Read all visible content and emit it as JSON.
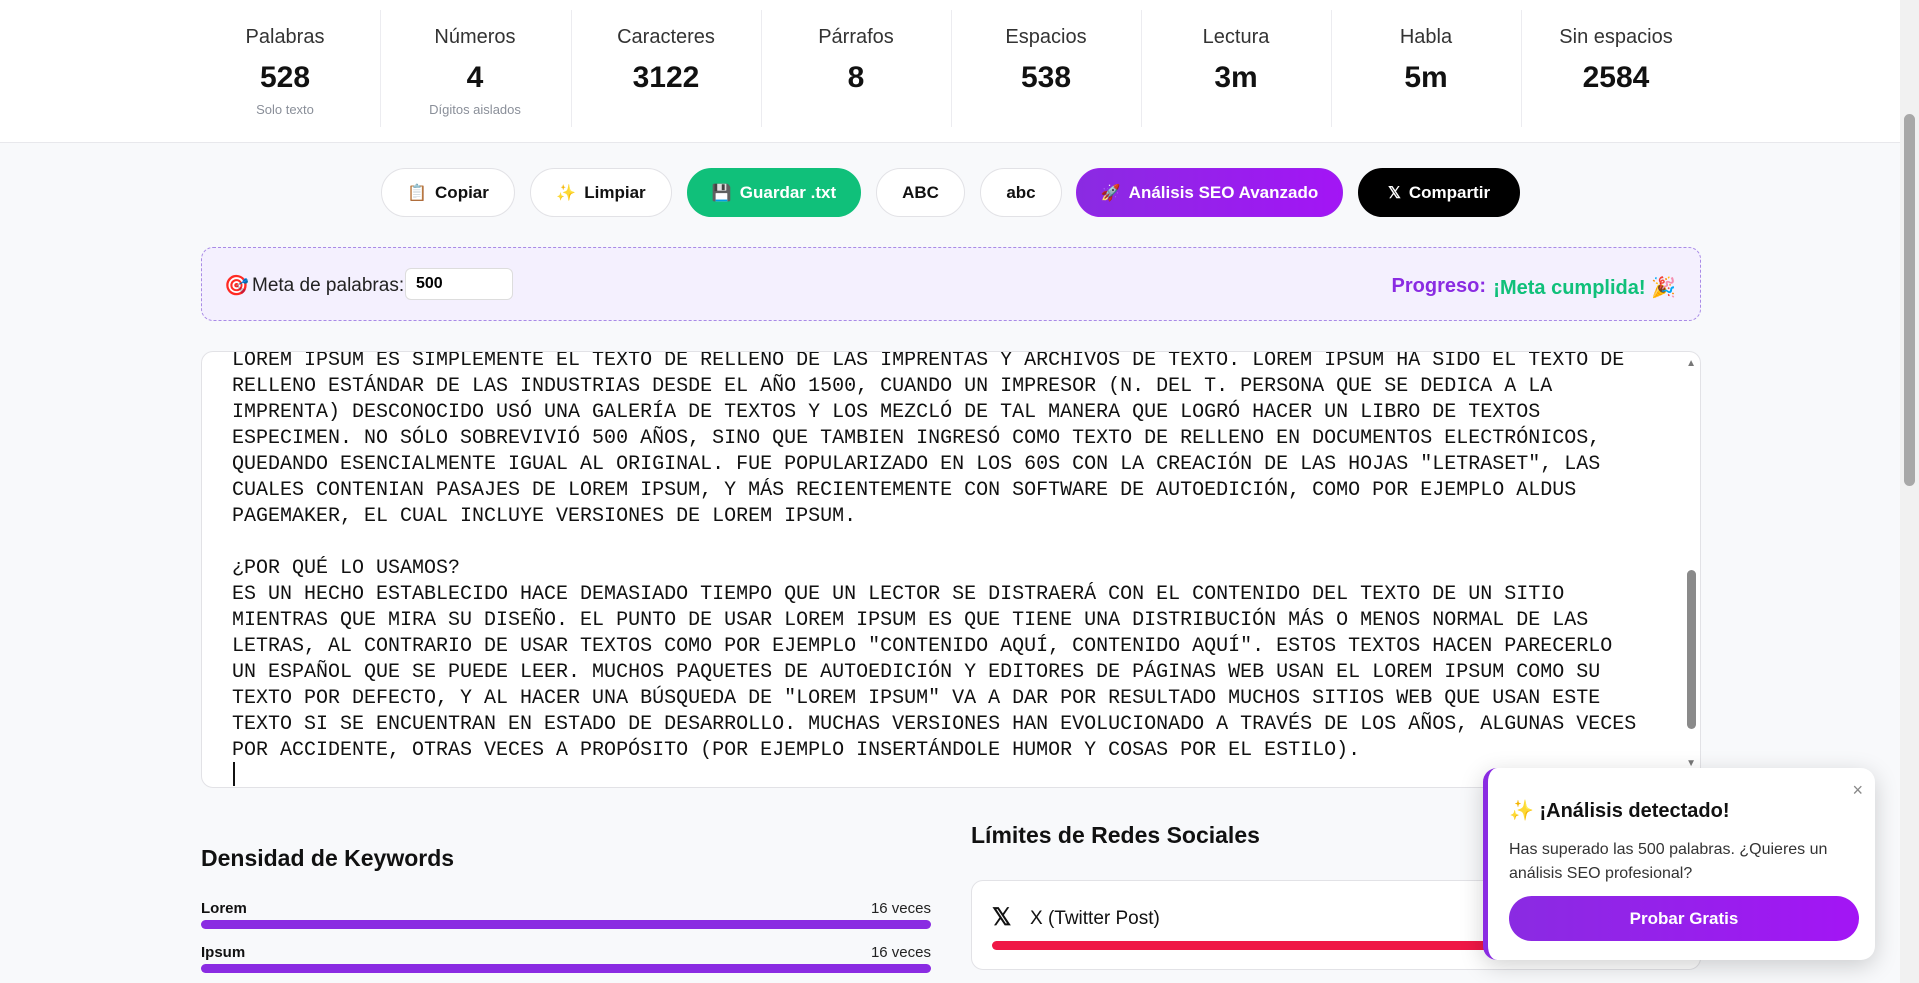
{
  "stats": [
    {
      "label": "Palabras",
      "value": "528",
      "sub": "Solo texto"
    },
    {
      "label": "Números",
      "value": "4",
      "sub": "Dígitos aislados"
    },
    {
      "label": "Caracteres",
      "value": "3122",
      "sub": ""
    },
    {
      "label": "Párrafos",
      "value": "8",
      "sub": ""
    },
    {
      "label": "Espacios",
      "value": "538",
      "sub": ""
    },
    {
      "label": "Lectura",
      "value": "3m",
      "sub": ""
    },
    {
      "label": "Habla",
      "value": "5m",
      "sub": ""
    },
    {
      "label": "Sin espacios",
      "value": "2584",
      "sub": ""
    }
  ],
  "toolbar": {
    "copy": {
      "icon": "📋",
      "label": "Copiar"
    },
    "clear": {
      "icon": "✨",
      "label": "Limpiar"
    },
    "save": {
      "icon": "💾",
      "label": "Guardar .txt"
    },
    "upper": {
      "label": "ABC"
    },
    "lower": {
      "label": "abc"
    },
    "seo": {
      "icon": "🚀",
      "label": "Análisis SEO Avanzado"
    },
    "share": {
      "icon": "𝕏",
      "label": "Compartir"
    }
  },
  "goal": {
    "icon": "🎯",
    "label": "Meta de palabras:",
    "value": "500",
    "progress_label": "Progreso:",
    "progress_value": "¡Meta cumplida! 🎉"
  },
  "editor": {
    "text": "LOREM IPSUM ES SIMPLEMENTE EL TEXTO DE RELLENO DE LAS IMPRENTAS Y ARCHIVOS DE TEXTO. LOREM IPSUM HA SIDO EL TEXTO DE\nRELLENO ESTÁNDAR DE LAS INDUSTRIAS DESDE EL AÑO 1500, CUANDO UN IMPRESOR (N. DEL T. PERSONA QUE SE DEDICA A LA\nIMPRENTA) DESCONOCIDO USÓ UNA GALERÍA DE TEXTOS Y LOS MEZCLÓ DE TAL MANERA QUE LOGRÓ HACER UN LIBRO DE TEXTOS\nESPECIMEN. NO SÓLO SOBREVIVIÓ 500 AÑOS, SINO QUE TAMBIEN INGRESÓ COMO TEXTO DE RELLENO EN DOCUMENTOS ELECTRÓNICOS,\nQUEDANDO ESENCIALMENTE IGUAL AL ORIGINAL. FUE POPULARIZADO EN LOS 60S CON LA CREACIÓN DE LAS HOJAS \"LETRASET\", LAS\nCUALES CONTENIAN PASAJES DE LOREM IPSUM, Y MÁS RECIENTEMENTE CON SOFTWARE DE AUTOEDICIÓN, COMO POR EJEMPLO ALDUS\nPAGEMAKER, EL CUAL INCLUYE VERSIONES DE LOREM IPSUM.\n\n¿POR QUÉ LO USAMOS?\nES UN HECHO ESTABLECIDO HACE DEMASIADO TIEMPO QUE UN LECTOR SE DISTRAERÁ CON EL CONTENIDO DEL TEXTO DE UN SITIO\nMIENTRAS QUE MIRA SU DISEÑO. EL PUNTO DE USAR LOREM IPSUM ES QUE TIENE UNA DISTRIBUCIÓN MÁS O MENOS NORMAL DE LAS\nLETRAS, AL CONTRARIO DE USAR TEXTOS COMO POR EJEMPLO \"CONTENIDO AQUÍ, CONTENIDO AQUÍ\". ESTOS TEXTOS HACEN PARECERLO\nUN ESPAÑOL QUE SE PUEDE LEER. MUCHOS PAQUETES DE AUTOEDICIÓN Y EDITORES DE PÁGINAS WEB USAN EL LOREM IPSUM COMO SU\nTEXTO POR DEFECTO, Y AL HACER UNA BÚSQUEDA DE \"LOREM IPSUM\" VA A DAR POR RESULTADO MUCHOS SITIOS WEB QUE USAN ESTE\nTEXTO SI SE ENCUENTRAN EN ESTADO DE DESARROLLO. MUCHAS VERSIONES HAN EVOLUCIONADO A TRAVÉS DE LOS AÑOS, ALGUNAS VECES\nPOR ACCIDENTE, OTRAS VECES A PROPÓSITO (POR EJEMPLO INSERTÁNDOLE HUMOR Y COSAS POR EL ESTILO)."
  },
  "keywords": {
    "title": "Densidad de Keywords",
    "items": [
      {
        "word": "Lorem",
        "count": "16 veces",
        "fraction": 1.0
      },
      {
        "word": "Ipsum",
        "count": "16 veces",
        "fraction": 1.0
      }
    ]
  },
  "social": {
    "title": "Límites de Redes Sociales",
    "items": [
      {
        "icon": "𝕏",
        "network": "X (Twitter Post)",
        "usage_fraction": 1.0,
        "color": "#ef1846"
      }
    ]
  },
  "popup": {
    "title": "✨ ¡Análisis detectado!",
    "text": "Has superado las 500 palabras. ¿Quieres un análisis SEO profesional?",
    "button": "Probar Gratis",
    "close": "×"
  },
  "colors": {
    "accent": "#8a2be2",
    "success": "#10c07a",
    "danger": "#ef1846"
  }
}
